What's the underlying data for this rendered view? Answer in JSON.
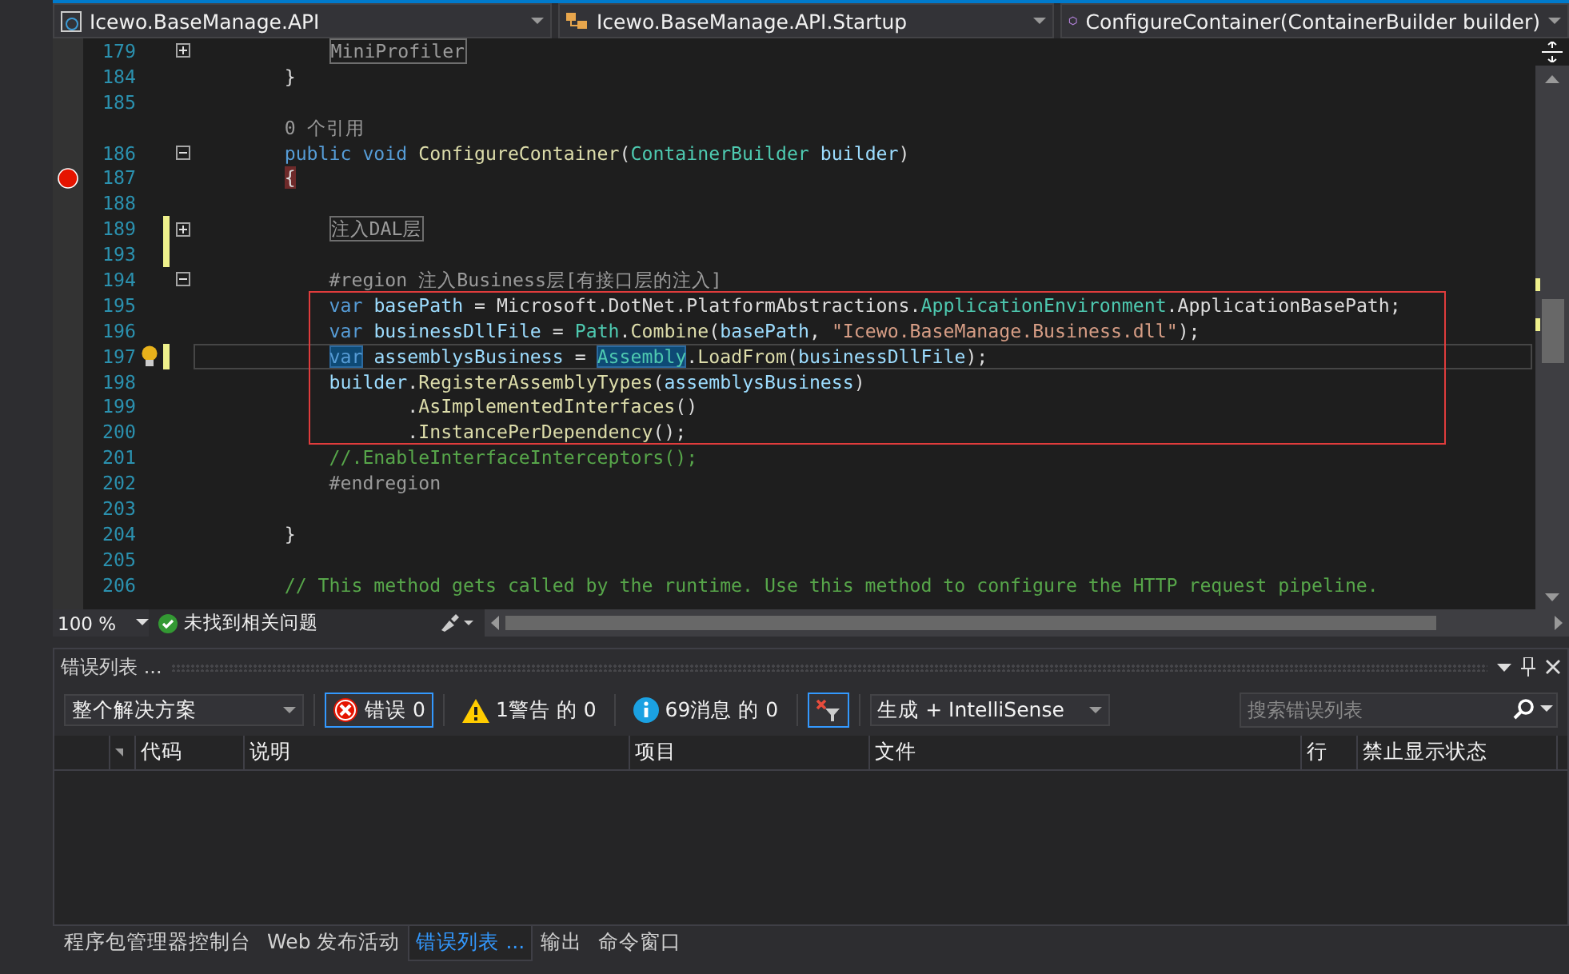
{
  "nav_bar": {
    "project": "Icewo.BaseManage.API",
    "class": "Icewo.BaseManage.API.Startup",
    "member": "ConfigureContainer(ContainerBuilder builder)"
  },
  "editor": {
    "lines": [
      {
        "kind": "code",
        "number": "179",
        "foldable": true,
        "expanded": false,
        "tokens": [
          {
            "kind": "collapsed",
            "text": "            MiniProfiler"
          }
        ]
      },
      {
        "kind": "code",
        "number": "184",
        "tokens": [
          {
            "kind": "plain",
            "text": "        }"
          }
        ]
      },
      {
        "kind": "code",
        "number": "185"
      },
      {
        "kind": "codelens",
        "tokens": [
          {
            "kind": "lens",
            "text": "        0 个引用"
          }
        ]
      },
      {
        "kind": "code",
        "number": "186",
        "foldable": true,
        "expanded": true,
        "tokens": [
          {
            "kind": "keyword",
            "text": "        public void "
          },
          {
            "kind": "method",
            "text": "ConfigureContainer"
          },
          {
            "kind": "plain",
            "text": "("
          },
          {
            "kind": "type",
            "text": "ContainerBuilder"
          },
          {
            "kind": "param",
            "text": " builder"
          },
          {
            "kind": "plain",
            "text": ")"
          }
        ]
      },
      {
        "kind": "code",
        "number": "187",
        "breakpoint": true,
        "tokens": [
          {
            "kind": "brace",
            "text": "        {"
          }
        ]
      },
      {
        "kind": "code",
        "number": "188"
      },
      {
        "kind": "code",
        "number": "189",
        "foldable": true,
        "expanded": false,
        "changed": true,
        "tokens": [
          {
            "kind": "collapsed",
            "text": "            注入DAL层"
          }
        ]
      },
      {
        "kind": "code",
        "number": "193",
        "changed": true
      },
      {
        "kind": "code",
        "number": "194",
        "foldable": true,
        "expanded": true,
        "tokens": [
          {
            "kind": "preproc",
            "text": "            #region 注入Business层[有接口层的注入]"
          }
        ]
      },
      {
        "kind": "code",
        "number": "195",
        "tokens": [
          {
            "kind": "keyword",
            "text": "            var"
          },
          {
            "kind": "param",
            "text": " basePath"
          },
          {
            "kind": "plain",
            "text": " = Microsoft.DotNet.PlatformAbstractions."
          },
          {
            "kind": "type",
            "text": "ApplicationEnvironment"
          },
          {
            "kind": "plain",
            "text": ".ApplicationBasePath;"
          }
        ]
      },
      {
        "kind": "code",
        "number": "196",
        "tokens": [
          {
            "kind": "keyword",
            "text": "            var"
          },
          {
            "kind": "param",
            "text": " businessDllFile"
          },
          {
            "kind": "plain",
            "text": " = "
          },
          {
            "kind": "type",
            "text": "Path"
          },
          {
            "kind": "plain",
            "text": "."
          },
          {
            "kind": "method",
            "text": "Combine"
          },
          {
            "kind": "plain",
            "text": "("
          },
          {
            "kind": "param",
            "text": "basePath"
          },
          {
            "kind": "plain",
            "text": ", "
          },
          {
            "kind": "string",
            "text": "\"Icewo.BaseManage.Business.dll\""
          },
          {
            "kind": "plain",
            "text": ");"
          }
        ]
      },
      {
        "kind": "code",
        "number": "197",
        "lightbulb": true,
        "changed": true,
        "current": true,
        "tokens": [
          {
            "kind": "keyword",
            "text": "            var",
            "highlighted": true
          },
          {
            "kind": "param",
            "text": " assemblysBusiness"
          },
          {
            "kind": "plain",
            "text": " = "
          },
          {
            "kind": "type",
            "text": "Assembly",
            "highlighted": true
          },
          {
            "kind": "plain",
            "text": "."
          },
          {
            "kind": "method",
            "text": "LoadFrom"
          },
          {
            "kind": "plain",
            "text": "("
          },
          {
            "kind": "param",
            "text": "businessDllFile"
          },
          {
            "kind": "plain",
            "text": ");"
          }
        ]
      },
      {
        "kind": "code",
        "number": "198",
        "tokens": [
          {
            "kind": "param",
            "text": "            builder"
          },
          {
            "kind": "plain",
            "text": "."
          },
          {
            "kind": "method",
            "text": "RegisterAssemblyTypes"
          },
          {
            "kind": "plain",
            "text": "("
          },
          {
            "kind": "param",
            "text": "assemblysBusiness"
          },
          {
            "kind": "plain",
            "text": ")"
          }
        ]
      },
      {
        "kind": "code",
        "number": "199",
        "tokens": [
          {
            "kind": "plain",
            "text": "                   ."
          },
          {
            "kind": "method",
            "text": "AsImplementedInterfaces"
          },
          {
            "kind": "plain",
            "text": "()"
          }
        ]
      },
      {
        "kind": "code",
        "number": "200",
        "tokens": [
          {
            "kind": "plain",
            "text": "                   ."
          },
          {
            "kind": "method",
            "text": "InstancePerDependency"
          },
          {
            "kind": "plain",
            "text": "();"
          }
        ]
      },
      {
        "kind": "code",
        "number": "201",
        "tokens": [
          {
            "kind": "comment",
            "text": "            //.EnableInterfaceInterceptors();"
          }
        ]
      },
      {
        "kind": "code",
        "number": "202",
        "tokens": [
          {
            "kind": "preproc",
            "text": "            #endregion"
          }
        ]
      },
      {
        "kind": "code",
        "number": "203"
      },
      {
        "kind": "code",
        "number": "204",
        "tokens": [
          {
            "kind": "plain",
            "text": "        }"
          }
        ]
      },
      {
        "kind": "code",
        "number": "205"
      },
      {
        "kind": "code",
        "number": "206",
        "tokens": [
          {
            "kind": "comment",
            "text": "        // This method gets called by the runtime. Use this method to configure the HTTP request pipeline."
          }
        ]
      }
    ]
  },
  "status_row": {
    "zoom": "100 %",
    "issues": "未找到相关问题"
  },
  "error_list": {
    "title": "错误列表 ...",
    "scope": "整个解决方案",
    "filters": [
      {
        "kind": "error",
        "label": "错误 0",
        "selected": true
      },
      {
        "kind": "warning",
        "label": "1警告 的 0",
        "selected": false
      },
      {
        "kind": "message",
        "label": "69消息 的 0",
        "selected": false
      }
    ],
    "filter_button": {
      "selected": true
    },
    "source": "生成 + IntelliSense",
    "search": {
      "placeholder": "搜索错误列表"
    },
    "columns": [
      "代码",
      "说明",
      "项目",
      "文件",
      "行",
      "禁止显示状态"
    ]
  },
  "bottom_tabs": [
    {
      "label": "程序包管理器控制台",
      "selected": false
    },
    {
      "label": "Web 发布活动",
      "selected": false
    },
    {
      "label": "错误列表 ...",
      "selected": true
    },
    {
      "label": "输出",
      "selected": false
    },
    {
      "label": "命令窗口",
      "selected": false
    }
  ]
}
